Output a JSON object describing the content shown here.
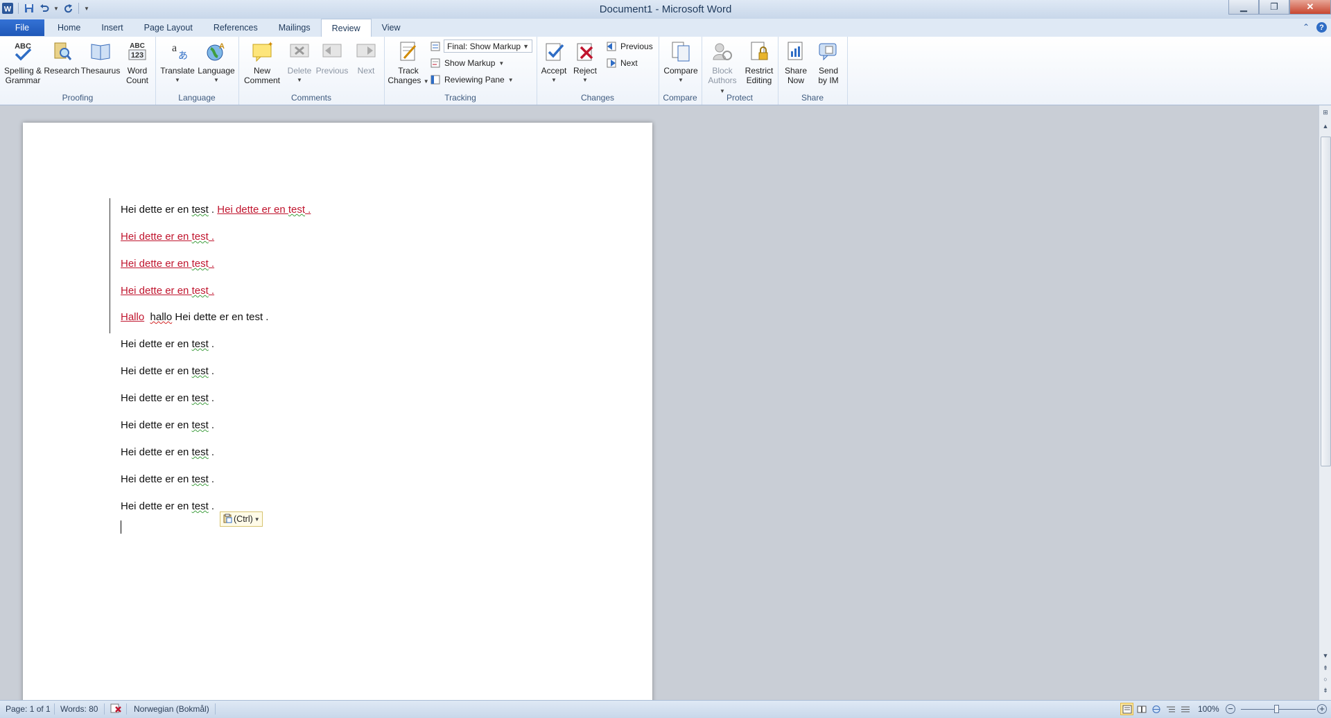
{
  "window": {
    "title": "Document1 - Microsoft Word"
  },
  "tabs": {
    "file": "File",
    "items": [
      "Home",
      "Insert",
      "Page Layout",
      "References",
      "Mailings",
      "Review",
      "View"
    ],
    "active": "Review"
  },
  "ribbon": {
    "proofing": {
      "label": "Proofing",
      "spelling": [
        "Spelling &",
        "Grammar"
      ],
      "research": "Research",
      "thesaurus": "Thesaurus",
      "word_count": [
        "Word",
        "Count"
      ]
    },
    "language": {
      "label": "Language",
      "translate": "Translate",
      "language": "Language"
    },
    "comments": {
      "label": "Comments",
      "new_comment": [
        "New",
        "Comment"
      ],
      "delete": "Delete",
      "previous": "Previous",
      "next": "Next"
    },
    "tracking": {
      "label": "Tracking",
      "track_changes": [
        "Track",
        "Changes"
      ],
      "display_combo": "Final: Show Markup",
      "show_markup": "Show Markup",
      "reviewing_pane": "Reviewing Pane"
    },
    "changes": {
      "label": "Changes",
      "accept": "Accept",
      "reject": "Reject",
      "previous": "Previous",
      "next": "Next"
    },
    "compare": {
      "label": "Compare",
      "compare": "Compare"
    },
    "protect": {
      "label": "Protect",
      "block_authors": [
        "Block",
        "Authors"
      ],
      "restrict_editing": [
        "Restrict",
        "Editing"
      ]
    },
    "share": {
      "label": "Share",
      "share_now": [
        "Share",
        "Now"
      ],
      "send_by_im": [
        "Send",
        "by IM"
      ]
    }
  },
  "document": {
    "line1_a": "Hei dette er en ",
    "line1_b": "test",
    "line1_c": " . ",
    "line1_d": "Hei dette er en ",
    "line1_e": "test",
    "line1_f": " .",
    "inserted_line": "Hei dette er en ",
    "inserted_word": "test",
    "inserted_end": " .",
    "line5_a": "Hallo",
    "line5_b": "hallo",
    "line5_c": " Hei dette er en test .",
    "plain_a": "Hei dette er en ",
    "plain_word": "test",
    "plain_end": " .",
    "paste_options": "(Ctrl)"
  },
  "status": {
    "page": "Page: 1 of 1",
    "words": "Words: 80",
    "language": "Norwegian (Bokmål)",
    "zoom": "100%"
  },
  "colors": {
    "accent": "#2b579a",
    "inserted_text": "#c0152e"
  }
}
